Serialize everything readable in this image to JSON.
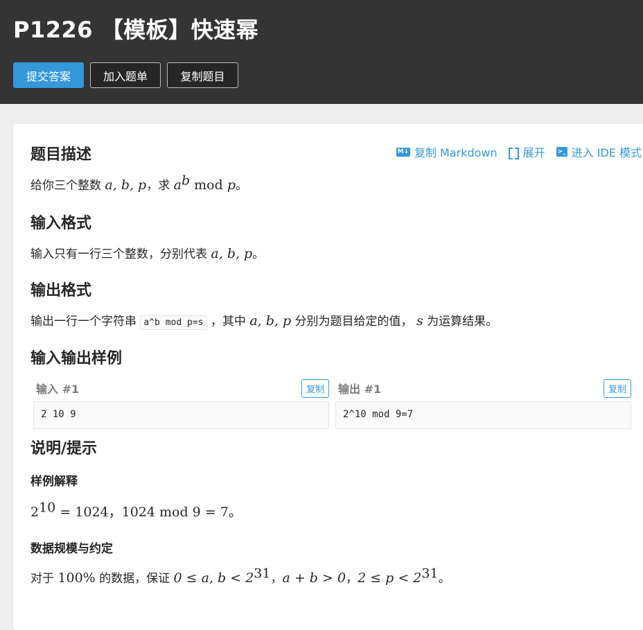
{
  "header": {
    "title": "P1226 【模板】快速幂",
    "buttons": {
      "submit": "提交答案",
      "add_to_list": "加入题单",
      "copy_problem": "复制题目"
    }
  },
  "toolbar": {
    "copy_markdown": "复制 Markdown",
    "expand": "展开",
    "ide_mode": "进入 IDE 模式",
    "md_icon_text": "M↓",
    "ide_icon_text": ">_"
  },
  "description": {
    "heading": "题目描述",
    "text_prefix": "给你三个整数 ",
    "vars": "a, b, p",
    "text_mid": "，求 ",
    "expr_base": "a",
    "expr_exp": "b",
    "expr_mod": " mod ",
    "expr_p": "p",
    "text_end": "。"
  },
  "input_format": {
    "heading": "输入格式",
    "text_prefix": "输入只有一行三个整数，分别代表 ",
    "vars": "a, b, p",
    "text_end": "。"
  },
  "output_format": {
    "heading": "输出格式",
    "text_prefix": "输出一行一个字符串 ",
    "code": "a^b mod p=s",
    "text_mid": " ，其中 ",
    "vars": "a, b, p",
    "text_mid2": " 分别为题目给定的值， ",
    "var_s": "s",
    "text_end": " 为运算结果。"
  },
  "samples": {
    "heading": "输入输出样例",
    "copy_label": "复制",
    "input": {
      "label": "输入 #1",
      "content": "2 10 9"
    },
    "output": {
      "label": "输出 #1",
      "content": "2^10 mod 9=7"
    }
  },
  "hint": {
    "heading": "说明/提示",
    "sample_explain_heading": "样例解释",
    "sample_explain_base": "2",
    "sample_explain_exp": "10",
    "sample_explain_rest": " = 1024，1024 mod 9 = 7。",
    "constraints_heading": "数据规模与约定",
    "constraints_prefix": "对于 ",
    "constraints_pct": "100%",
    "constraints_mid": " 的数据，保证 ",
    "constraints_math1": "0 ≤ a, b < 2",
    "constraints_exp1": "31",
    "constraints_sep1": "，",
    "constraints_math2": "a + b > 0",
    "constraints_sep2": "，",
    "constraints_math3": "2 ≤ p < 2",
    "constraints_exp3": "31",
    "constraints_end": "。"
  }
}
